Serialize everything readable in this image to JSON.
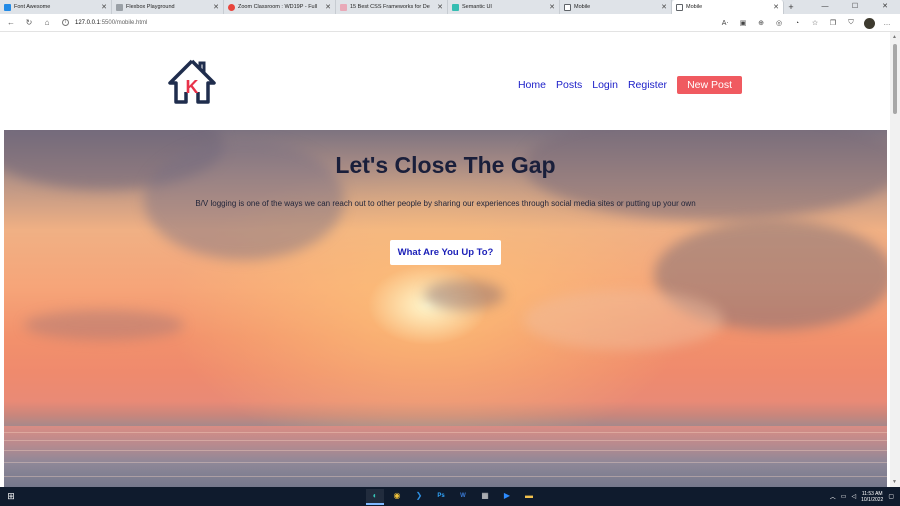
{
  "browser": {
    "tabs": [
      {
        "label": "Font Awesome",
        "favicon_color": "#228ae6"
      },
      {
        "label": "Flexbox Playground",
        "favicon_color": "#9aa0a6"
      },
      {
        "label": "Zoom Classroom : WD19P - Full",
        "favicon_color": "#e8453c"
      },
      {
        "label": "15 Best CSS Frameworks for De",
        "favicon_color": "#e9a9b8"
      },
      {
        "label": "Semantic UI",
        "favicon_color": "#35bdb2"
      },
      {
        "label": "Mobile",
        "favicon_color": "#5f6368"
      },
      {
        "label": "Mobile",
        "favicon_color": "#5f6368"
      }
    ],
    "active_tab": 6,
    "new_tab_symbol": "+",
    "url_host": "127.0.0.1",
    "url_path": ":5500/mobile.html",
    "icons": [
      "back-icon",
      "refresh-icon",
      "home-icon",
      "read-aloud-icon",
      "immersive-reader-icon",
      "zoom-icon",
      "extensions-icon",
      "favorites-icon",
      "collections-icon",
      "shield-icon",
      "profile-avatar",
      "menu-icon"
    ]
  },
  "site": {
    "logo_letter": "K",
    "nav": {
      "home": "Home",
      "posts": "Posts",
      "login": "Login",
      "register": "Register",
      "new_post": "New Post"
    },
    "hero": {
      "title": "Let's Close The Gap",
      "subtitle": "B/V logging is one of the ways we can reach out to other people by sharing our experiences through social media sites or putting up your own",
      "button": "What Are You Up To?"
    }
  },
  "taskbar": {
    "time": "11:53 AM",
    "date": "10/1/2022",
    "apps": [
      "edge-icon",
      "chrome-icon",
      "vscode-icon",
      "photoshop-icon",
      "word-icon",
      "calculator-icon",
      "zoom-icon",
      "file-explorer-icon"
    ]
  },
  "colors": {
    "nav_link": "#1e21c9",
    "cta": "#f05a60",
    "title": "#1a1f3b",
    "logo_dark": "#1f2d4d",
    "logo_accent": "#e8334a"
  }
}
